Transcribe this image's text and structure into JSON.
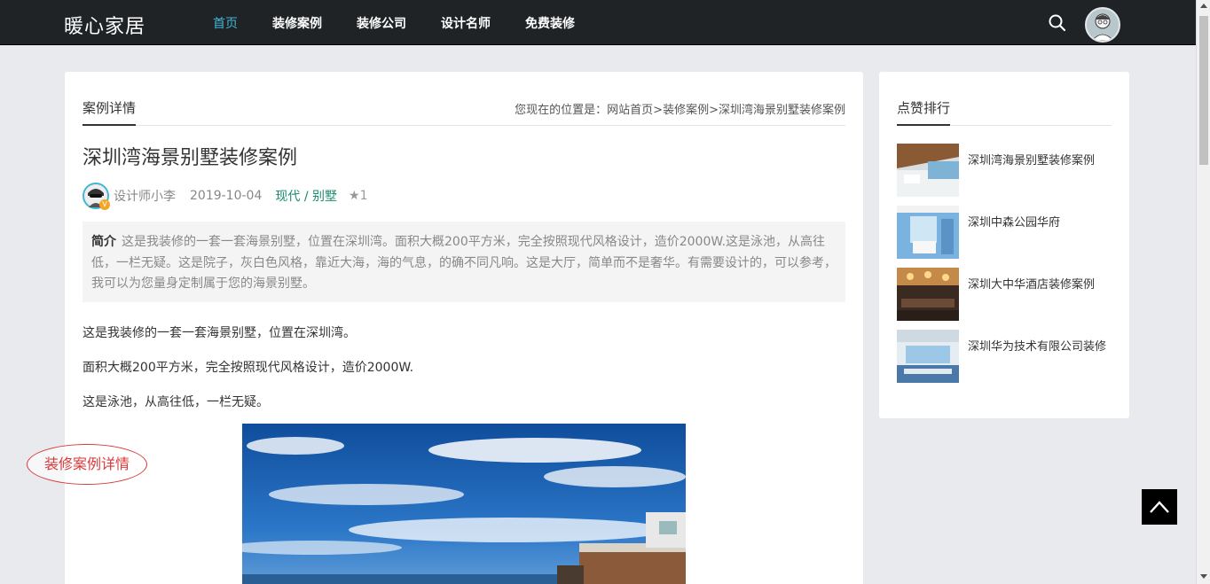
{
  "site": {
    "logo": "暖心家居"
  },
  "nav": {
    "items": [
      {
        "label": "首页",
        "active": true
      },
      {
        "label": "装修案例",
        "active": false
      },
      {
        "label": "装修公司",
        "active": false
      },
      {
        "label": "设计名师",
        "active": false
      },
      {
        "label": "免费装修",
        "active": false
      }
    ],
    "search_icon": "search-icon"
  },
  "main": {
    "section_title": "案例详情",
    "breadcrumb": {
      "prefix": "您现在的位置是：",
      "items": [
        "网站首页",
        "装修案例",
        "深圳湾海景别墅装修案例"
      ],
      "sep": ">"
    },
    "title": "深圳湾海景别墅装修案例",
    "author": "设计师小李",
    "date": "2019-10-04",
    "tags": "现代 / 别墅",
    "likes": "1",
    "intro_label": "简介",
    "intro_text": "这是我装修的一套一套海景别墅，位置在深圳湾。面积大概200平方米，完全按照现代风格设计，造价2000W.这是泳池，从高往低，一栏无疑。这是院子，灰白色风格，靠近大海，海的气息，的确不同凡响。这是大厅，简单而不是奢华。有需要设计的，可以参考，我可以为您量身定制属于您的海景别墅。",
    "paragraphs": [
      "这是我装修的一套一套海景别墅，位置在深圳湾。",
      "面积大概200平方米，完全按照现代风格设计，造价2000W.",
      "这是泳池，从高往低，一栏无疑。"
    ]
  },
  "annotation": "装修案例详情",
  "sidebar": {
    "title": "点赞排行",
    "items": [
      {
        "label": "深圳湾海景别墅装修案例"
      },
      {
        "label": "深圳中森公园华府"
      },
      {
        "label": "深圳大中华酒店装修案例"
      },
      {
        "label": "深圳华为技术有限公司装修"
      }
    ]
  },
  "colors": {
    "nav_bg": "#1f2326",
    "nav_active": "#3fb7d9",
    "tag_green": "#1a8a6e",
    "annotation_red": "#d73a3a"
  }
}
